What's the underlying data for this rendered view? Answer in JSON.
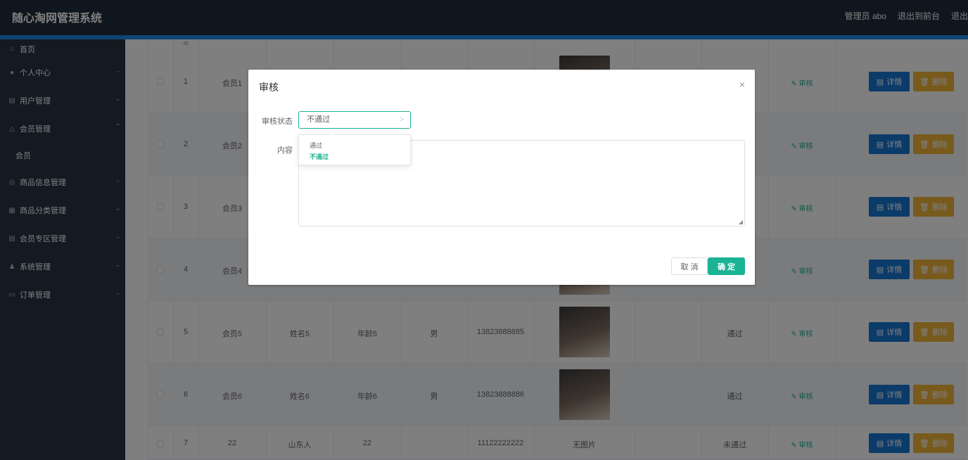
{
  "header": {
    "title": "随心淘网管理系统",
    "admin_label": "管理员 abo",
    "back_label": "退出到前台",
    "logout_label": "退出"
  },
  "sidebar": {
    "items": [
      {
        "label": "首页",
        "icon": "home-icon"
      },
      {
        "label": "个人中心",
        "icon": "user-icon"
      },
      {
        "label": "用户管理",
        "icon": "clipboard-icon"
      },
      {
        "label": "会员管理",
        "icon": "bell-icon"
      },
      {
        "label": "会员",
        "icon": ""
      },
      {
        "label": "商品信息管理",
        "icon": "info-icon"
      },
      {
        "label": "商品分类管理",
        "icon": "grid-icon"
      },
      {
        "label": "会员专区管理",
        "icon": "clipboard-icon"
      },
      {
        "label": "系统管理",
        "icon": "person-icon"
      },
      {
        "label": "订单管理",
        "icon": "message-icon"
      }
    ]
  },
  "table": {
    "header_fragment": "st",
    "rows": [
      {
        "index": "1",
        "account": "会员1",
        "name": "",
        "age": "",
        "gender": "",
        "phone": "",
        "photo": "",
        "status": ""
      },
      {
        "index": "2",
        "account": "会员2",
        "name": "",
        "age": "",
        "gender": "",
        "phone": "",
        "photo": "",
        "status": ""
      },
      {
        "index": "3",
        "account": "会员3",
        "name": "",
        "age": "",
        "gender": "",
        "phone": "",
        "photo": "",
        "status": ""
      },
      {
        "index": "4",
        "account": "会员4",
        "name": "",
        "age": "",
        "gender": "",
        "phone": "",
        "photo": "",
        "status": ""
      },
      {
        "index": "5",
        "account": "会员5",
        "name": "姓名5",
        "age": "年龄5",
        "gender": "男",
        "phone": "13823888885",
        "photo": "",
        "status": "通过"
      },
      {
        "index": "6",
        "account": "会员6",
        "name": "姓名6",
        "age": "年龄6",
        "gender": "男",
        "phone": "13823888886",
        "photo": "",
        "status": "通过"
      },
      {
        "index": "7",
        "account": "22",
        "name": "山东人",
        "age": "22",
        "gender": "",
        "phone": "11122222222",
        "photo": "无图片",
        "status": "未通过"
      }
    ],
    "audit_label": "审核",
    "detail_label": "详情",
    "delete_label": "删除"
  },
  "dialog": {
    "title": "审核",
    "status_label": "审核状态",
    "status_value": "不通过",
    "content_label": "内容",
    "options": [
      "通过",
      "不通过"
    ],
    "cancel_label": "取 消",
    "confirm_label": "确 定"
  },
  "colors": {
    "header_bg": "#1f2d3d",
    "sidebar_bg": "#263445",
    "accent": "#1ab394",
    "detail_btn": "#1677d2",
    "delete_btn": "#f0b43a"
  }
}
